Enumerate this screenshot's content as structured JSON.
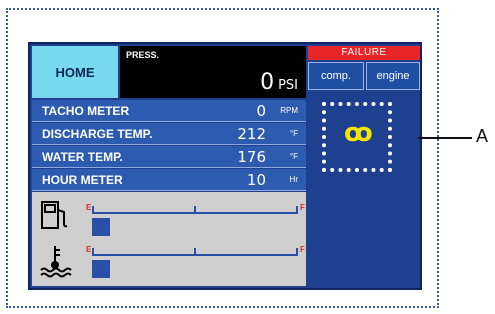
{
  "screen": {
    "home_label": "HOME",
    "pressure": {
      "label": "PRESS.",
      "value": "0",
      "unit": "PSI"
    },
    "failure_label": "FAILURE",
    "tabs": [
      {
        "label": "comp."
      },
      {
        "label": "engine"
      }
    ],
    "readings": [
      {
        "label": "TACHO METER",
        "value": "0",
        "unit": "RPM"
      },
      {
        "label": "DISCHARGE TEMP.",
        "value": "212",
        "unit": "°F"
      },
      {
        "label": "WATER TEMP.",
        "value": "176",
        "unit": "°F"
      },
      {
        "label": "HOUR METER",
        "value": "10",
        "unit": "Hr"
      }
    ],
    "gauges": [
      {
        "icon": "fuel-pump-icon",
        "empty_label": "E",
        "full_label": "F"
      },
      {
        "icon": "coolant-temperature-icon",
        "empty_label": "E",
        "full_label": "F"
      }
    ],
    "glow_indicator": {
      "icon": "glow-plug-icon",
      "glyph": "ꝏ"
    }
  },
  "callout": {
    "label": "A"
  },
  "colors": {
    "panel": "#1f3f8f",
    "home": "#78d9ee",
    "failure": "#e8262a",
    "glow": "#f4e400"
  }
}
